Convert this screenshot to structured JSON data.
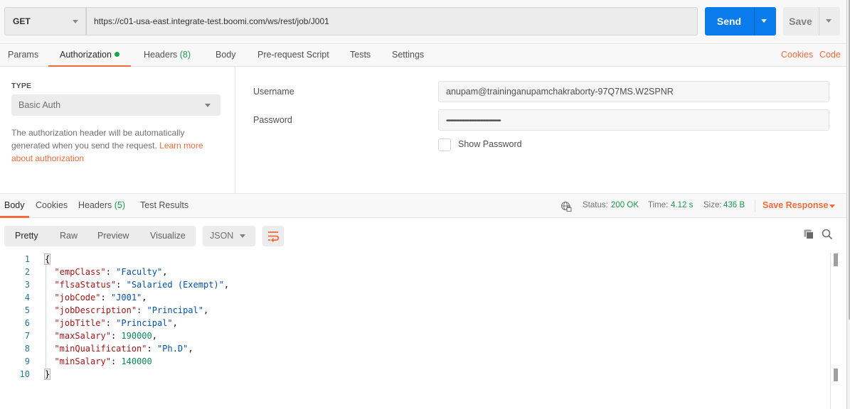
{
  "request": {
    "method": "GET",
    "url": "https://c01-usa-east.integrate-test.boomi.com/ws/rest/job/J001",
    "send_label": "Send",
    "save_label": "Save"
  },
  "request_tabs": {
    "params": "Params",
    "authorization": "Authorization",
    "headers": "Headers",
    "headers_count": "(8)",
    "body": "Body",
    "pre_request": "Pre-request Script",
    "tests": "Tests",
    "settings": "Settings",
    "cookies_link": "Cookies",
    "code_link": "Code"
  },
  "auth": {
    "type_label": "TYPE",
    "type_value": "Basic Auth",
    "description": "The authorization header will be automatically generated when you send the request. ",
    "learn_more": "Learn more about authorization",
    "username_label": "Username",
    "username_value": "anupam@traininganupamchakraborty-97Q7MS.W2SPNR",
    "password_label": "Password",
    "password_value": "••••••••••••••••••••••••••••••••••••••••",
    "show_password_label": "Show Password",
    "show_password_checked": false
  },
  "response_tabs": {
    "body": "Body",
    "cookies": "Cookies",
    "headers": "Headers",
    "headers_count": "(5)",
    "test_results": "Test Results"
  },
  "response_status": {
    "status_label": "Status:",
    "status_value": "200 OK",
    "time_label": "Time:",
    "time_value": "4.12 s",
    "size_label": "Size:",
    "size_value": "436 B",
    "save_response": "Save Response"
  },
  "body_toolbar": {
    "modes": [
      "Pretty",
      "Raw",
      "Preview",
      "Visualize"
    ],
    "active_mode": "Pretty",
    "format": "JSON"
  },
  "response_body": {
    "lines": [
      {
        "num": "1",
        "open": "{"
      },
      {
        "num": "2",
        "key": "\"empClass\"",
        "value": "\"Faculty\"",
        "type": "string",
        "comma": ","
      },
      {
        "num": "3",
        "key": "\"flsaStatus\"",
        "value": "\"Salaried (Exempt)\"",
        "type": "string",
        "comma": ","
      },
      {
        "num": "4",
        "key": "\"jobCode\"",
        "value": "\"J001\"",
        "type": "string",
        "comma": ","
      },
      {
        "num": "5",
        "key": "\"jobDescription\"",
        "value": "\"Principal\"",
        "type": "string",
        "comma": ","
      },
      {
        "num": "6",
        "key": "\"jobTitle\"",
        "value": "\"Principal\"",
        "type": "string",
        "comma": ","
      },
      {
        "num": "7",
        "key": "\"maxSalary\"",
        "value": "190000",
        "type": "number",
        "comma": ","
      },
      {
        "num": "8",
        "key": "\"minQualification\"",
        "value": "\"Ph.D\"",
        "type": "string",
        "comma": ","
      },
      {
        "num": "9",
        "key": "\"minSalary\"",
        "value": "140000",
        "type": "number",
        "comma": ""
      },
      {
        "num": "10",
        "close": "}"
      }
    ]
  },
  "colors": {
    "accent": "#f26b3a",
    "send_button": "#097bed",
    "success": "#1c9a4c",
    "json_key": "#a31515",
    "json_string": "#0451a5",
    "json_number": "#098658",
    "line_number": "#237893"
  },
  "icons": {
    "globe_lock": "globe-lock-icon",
    "wrap": "wrap-lines-icon",
    "copy": "copy-icon",
    "search": "search-icon"
  }
}
